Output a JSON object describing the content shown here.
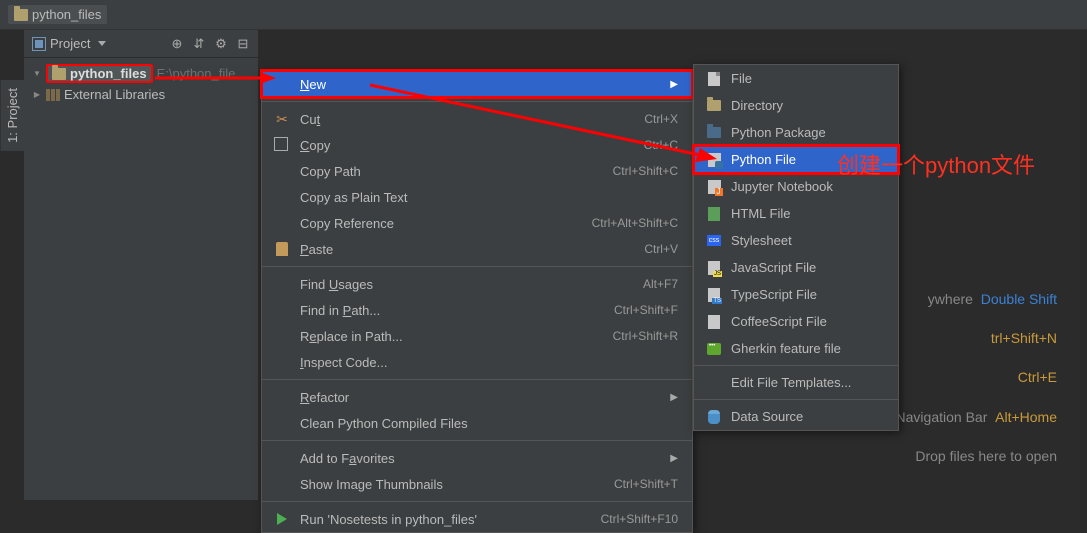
{
  "breadcrumb": {
    "project_name": "python_files"
  },
  "left_tab": {
    "label": "1: Project"
  },
  "project_panel": {
    "header_label": "Project",
    "toolbar_icons": [
      "target-icon",
      "collapse-icon",
      "gear-icon",
      "hide-icon"
    ],
    "root_name": "python_files",
    "root_path": "E:\\python_file",
    "external_libs": "External Libraries"
  },
  "context_menu": {
    "items": [
      {
        "label": "New",
        "shortcut": "",
        "hover": true,
        "submenu": true,
        "underline": 0,
        "icon": ""
      },
      {
        "sep": true
      },
      {
        "label": "Cut",
        "shortcut": "Ctrl+X",
        "icon": "scissors",
        "underline": 2
      },
      {
        "label": "Copy",
        "shortcut": "Ctrl+C",
        "icon": "copy",
        "underline": 0
      },
      {
        "label": "Copy Path",
        "shortcut": "Ctrl+Shift+C",
        "icon": ""
      },
      {
        "label": "Copy as Plain Text",
        "shortcut": "",
        "icon": ""
      },
      {
        "label": "Copy Reference",
        "shortcut": "Ctrl+Alt+Shift+C",
        "icon": ""
      },
      {
        "label": "Paste",
        "shortcut": "Ctrl+V",
        "icon": "paste",
        "underline": 0
      },
      {
        "sep": true
      },
      {
        "label": "Find Usages",
        "shortcut": "Alt+F7",
        "icon": "",
        "underline": 5
      },
      {
        "label": "Find in Path...",
        "shortcut": "Ctrl+Shift+F",
        "icon": "",
        "underline": 8
      },
      {
        "label": "Replace in Path...",
        "shortcut": "Ctrl+Shift+R",
        "icon": "",
        "underline": 1
      },
      {
        "label": "Inspect Code...",
        "shortcut": "",
        "icon": "",
        "underline": 0
      },
      {
        "sep": true
      },
      {
        "label": "Refactor",
        "shortcut": "",
        "icon": "",
        "submenu": true,
        "underline": 0
      },
      {
        "label": "Clean Python Compiled Files",
        "shortcut": "",
        "icon": ""
      },
      {
        "sep": true
      },
      {
        "label": "Add to Favorites",
        "shortcut": "",
        "icon": "",
        "submenu": true,
        "underline": 8
      },
      {
        "label": "Show Image Thumbnails",
        "shortcut": "Ctrl+Shift+T",
        "icon": ""
      },
      {
        "sep": true
      },
      {
        "label": "Run 'Nosetests in python_files'",
        "shortcut": "Ctrl+Shift+F10",
        "icon": "play"
      }
    ]
  },
  "submenu": {
    "items": [
      {
        "label": "File",
        "icon": "file"
      },
      {
        "label": "Directory",
        "icon": "dir"
      },
      {
        "label": "Python Package",
        "icon": "pypkg"
      },
      {
        "label": "Python File",
        "icon": "pyfile",
        "hover": true
      },
      {
        "label": "Jupyter Notebook",
        "icon": "jup"
      },
      {
        "label": "HTML File",
        "icon": "html"
      },
      {
        "label": "Stylesheet",
        "icon": "css"
      },
      {
        "label": "JavaScript File",
        "icon": "js"
      },
      {
        "label": "TypeScript File",
        "icon": "ts"
      },
      {
        "label": "CoffeeScript File",
        "icon": "coffee"
      },
      {
        "label": "Gherkin feature file",
        "icon": "gherkin"
      },
      {
        "sep": true
      },
      {
        "label": "Edit File Templates...",
        "icon": ""
      },
      {
        "sep": true
      },
      {
        "label": "Data Source",
        "icon": "db"
      }
    ]
  },
  "annotation": {
    "text": "创建一个python文件"
  },
  "hints": {
    "line1_suffix": "ywhere",
    "line1_key": "Double Shift",
    "line2_key": "trl+Shift+N",
    "line3_key": "Ctrl+E",
    "line4_label": "Navigation Bar",
    "line4_key": "Alt+Home",
    "line5_label": "Drop files here to open"
  }
}
